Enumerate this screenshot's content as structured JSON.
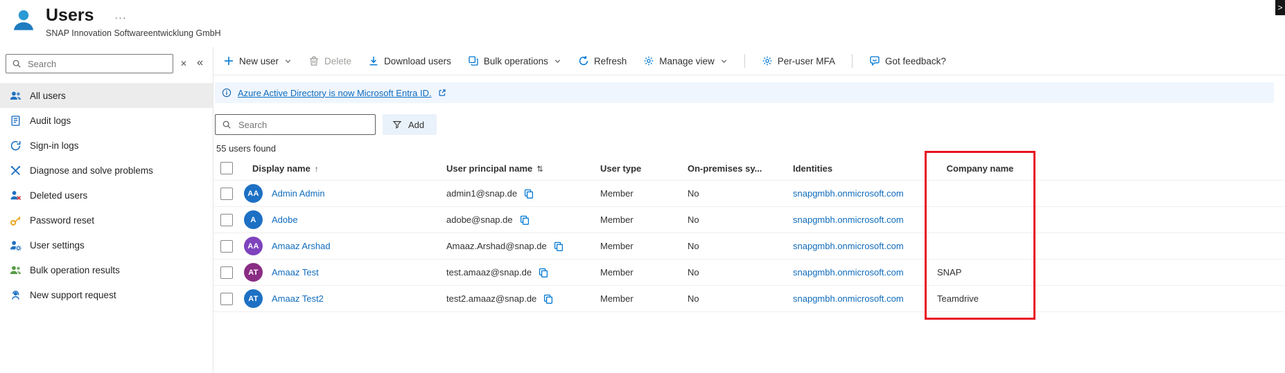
{
  "header": {
    "title": "Users",
    "more": "···",
    "subtitle": "SNAP Innovation Softwareentwicklung GmbH"
  },
  "right_edge": {
    "chevron": ">"
  },
  "sidebar": {
    "search": {
      "placeholder": "Search",
      "clear": "✕",
      "collapse": "«"
    },
    "items": [
      {
        "label": "All users",
        "icon": "people-icon",
        "icon_color": "#1d70c3",
        "active": true
      },
      {
        "label": "Audit logs",
        "icon": "audit-log-icon",
        "icon_color": "#1d70c3"
      },
      {
        "label": "Sign-in logs",
        "icon": "signin-log-icon",
        "icon_color": "#1d70c3"
      },
      {
        "label": "Diagnose and solve problems",
        "icon": "diagnose-icon",
        "icon_color": "#1d70c3"
      },
      {
        "label": "Deleted users",
        "icon": "deleted-user-icon",
        "icon_color": "#c74634"
      },
      {
        "label": "Password reset",
        "icon": "key-icon",
        "icon_color": "#eca41b"
      },
      {
        "label": "User settings",
        "icon": "user-gear-icon",
        "icon_color": "#1d70c3"
      },
      {
        "label": "Bulk operation results",
        "icon": "bulk-people-icon",
        "icon_color": "#569b46"
      },
      {
        "label": "New support request",
        "icon": "support-icon",
        "icon_color": "#1d70c3"
      }
    ]
  },
  "toolbar": {
    "items": [
      {
        "label": "New user",
        "icon": "plus-icon",
        "chevron": true
      },
      {
        "label": "Delete",
        "icon": "trash-icon",
        "disabled": true
      },
      {
        "label": "Download users",
        "icon": "download-icon"
      },
      {
        "label": "Bulk operations",
        "icon": "bulk-icon",
        "chevron": true
      },
      {
        "label": "Refresh",
        "icon": "refresh-icon"
      },
      {
        "label": "Manage view",
        "icon": "gear-icon",
        "chevron": true
      },
      {
        "separator": true
      },
      {
        "label": "Per-user MFA",
        "icon": "gear-icon"
      },
      {
        "separator": true
      },
      {
        "label": "Got feedback?",
        "icon": "feedback-icon"
      }
    ]
  },
  "banner": {
    "text": "Azure Active Directory is now Microsoft Entra ID."
  },
  "filter_bar": {
    "search_placeholder": "Search",
    "add_label": "Add"
  },
  "results_count": "55 users found",
  "table": {
    "columns": [
      {
        "label": "Display name",
        "sort": "↑"
      },
      {
        "label": "User principal name",
        "sort": "⇅"
      },
      {
        "label": "User type"
      },
      {
        "label": "On-premises sy..."
      },
      {
        "label": "Identities"
      },
      {
        "label": "Company name"
      }
    ],
    "rows": [
      {
        "initials": "AA",
        "avatar_color": "#1d70c3",
        "display_name": "Admin Admin",
        "upn": "admin1@snap.de",
        "user_type": "Member",
        "on_premises": "No",
        "identities": "snapgmbh.onmicrosoft.com",
        "company": ""
      },
      {
        "initials": "A",
        "avatar_color": "#1d70c3",
        "display_name": "Adobe",
        "upn": "adobe@snap.de",
        "user_type": "Member",
        "on_premises": "No",
        "identities": "snapgmbh.onmicrosoft.com",
        "company": ""
      },
      {
        "initials": "AA",
        "avatar_color": "#7e43bd",
        "display_name": "Amaaz Arshad",
        "upn": "Amaaz.Arshad@snap.de",
        "user_type": "Member",
        "on_premises": "No",
        "identities": "snapgmbh.onmicrosoft.com",
        "company": ""
      },
      {
        "initials": "AT",
        "avatar_color": "#8a2c84",
        "display_name": "Amaaz Test",
        "upn": "test.amaaz@snap.de",
        "user_type": "Member",
        "on_premises": "No",
        "identities": "snapgmbh.onmicrosoft.com",
        "company": "SNAP"
      },
      {
        "initials": "AT",
        "avatar_color": "#1d70c3",
        "display_name": "Amaaz Test2",
        "upn": "test2.amaaz@snap.de",
        "user_type": "Member",
        "on_premises": "No",
        "identities": "snapgmbh.onmicrosoft.com",
        "company": "Teamdrive"
      },
      {
        "initials": "",
        "avatar_color": "#3b3a39",
        "display_name": "",
        "upn": "",
        "user_type": "",
        "on_premises": "",
        "identities": "",
        "company": "",
        "partial": true
      }
    ]
  },
  "highlight": {
    "around": "Company name column",
    "color": "#e81123"
  },
  "colors": {
    "accent": "#0078d4",
    "link": "#0f6cbd",
    "banner_bg": "#f0f6fe",
    "selected_bg": "#ececec",
    "highlight": "#e81123"
  }
}
